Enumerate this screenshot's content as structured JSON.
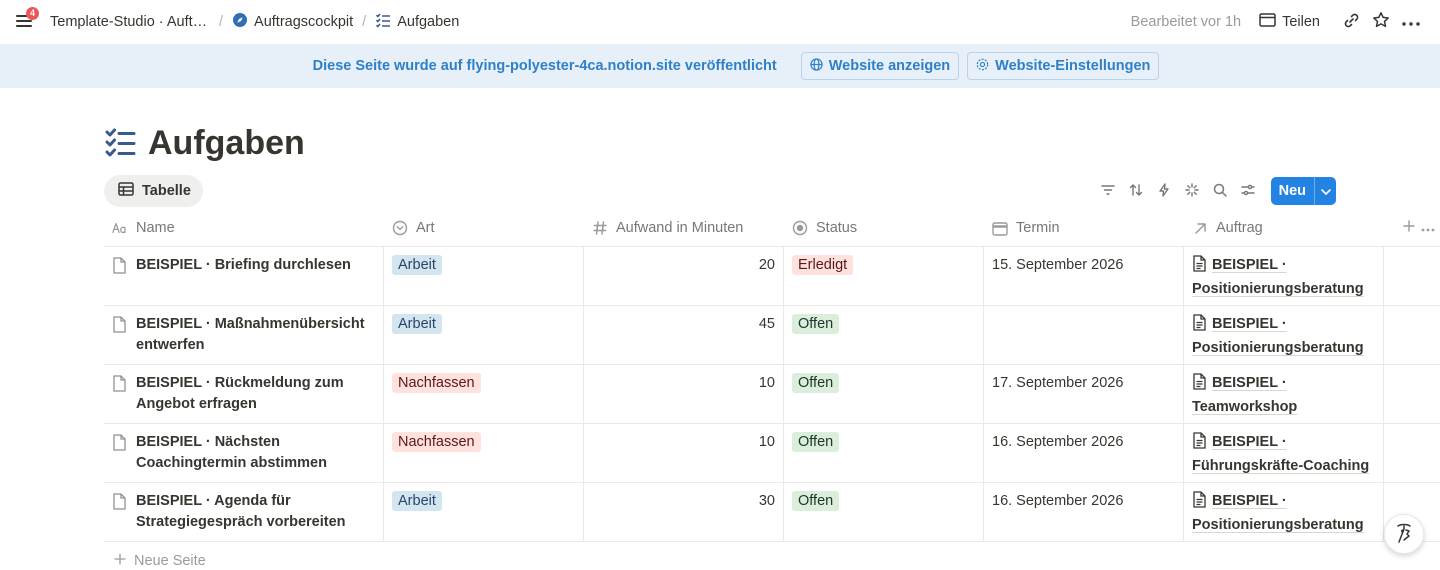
{
  "topbar": {
    "notification_count": "4",
    "breadcrumbs": [
      {
        "label": "Template-Studio · Aufträge",
        "icon": "workspace-none"
      },
      {
        "label": "Auftragscockpit",
        "icon": "compass-icon"
      },
      {
        "label": "Aufgaben",
        "icon": "checklist-icon"
      }
    ],
    "edited_label": "Bearbeitet vor 1h",
    "share_label": "Teilen"
  },
  "banner": {
    "text": "Diese Seite wurde auf flying-polyester-4ca.notion.site veröffentlicht",
    "view_site_label": "Website anzeigen",
    "site_settings_label": "Website-Einstellungen",
    "color": "#2f80c7"
  },
  "page": {
    "title": "Aufgaben",
    "view_tab_label": "Tabelle",
    "new_button_label": "Neu",
    "new_page_label": "Neue Seite"
  },
  "table": {
    "columns": {
      "name": "Name",
      "art": "Art",
      "aufwand": "Aufwand in Minuten",
      "status": "Status",
      "termin": "Termin",
      "auftrag": "Auftrag"
    },
    "rows": [
      {
        "name": "BEISPIEL · Briefing durchlesen",
        "art": "Arbeit",
        "aufwand": "20",
        "status": "Erledigt",
        "termin": "15. September 2026",
        "auftrag": "BEISPIEL · Positionierungsberatung"
      },
      {
        "name": "BEISPIEL · Maßnahmenübersicht entwerfen",
        "art": "Arbeit",
        "aufwand": "45",
        "status": "Offen",
        "termin": "",
        "auftrag": "BEISPIEL · Positionierungsberatung"
      },
      {
        "name": "BEISPIEL · Rückmeldung zum Angebot erfragen",
        "art": "Nachfassen",
        "aufwand": "10",
        "status": "Offen",
        "termin": "17. September 2026",
        "auftrag": "BEISPIEL · Teamworkshop"
      },
      {
        "name": "BEISPIEL · Nächsten Coachingtermin abstimmen",
        "art": "Nachfassen",
        "aufwand": "10",
        "status": "Offen",
        "termin": "16. September 2026",
        "auftrag": "BEISPIEL · Führungskräfte-Coaching"
      },
      {
        "name": "BEISPIEL · Agenda für Strategiegespräch vorbereiten",
        "art": "Arbeit",
        "aufwand": "30",
        "status": "Offen",
        "termin": "16. September 2026",
        "auftrag": "BEISPIEL · Positionierungsberatung"
      }
    ]
  },
  "colors": {
    "accent": "#2383e2",
    "tag_arbeit_bg": "#d3e5ef",
    "tag_nachfassen_bg": "#ffe2dd",
    "tag_erledigt_bg": "#ffe2dd",
    "tag_offen_bg": "#dbeddb"
  }
}
